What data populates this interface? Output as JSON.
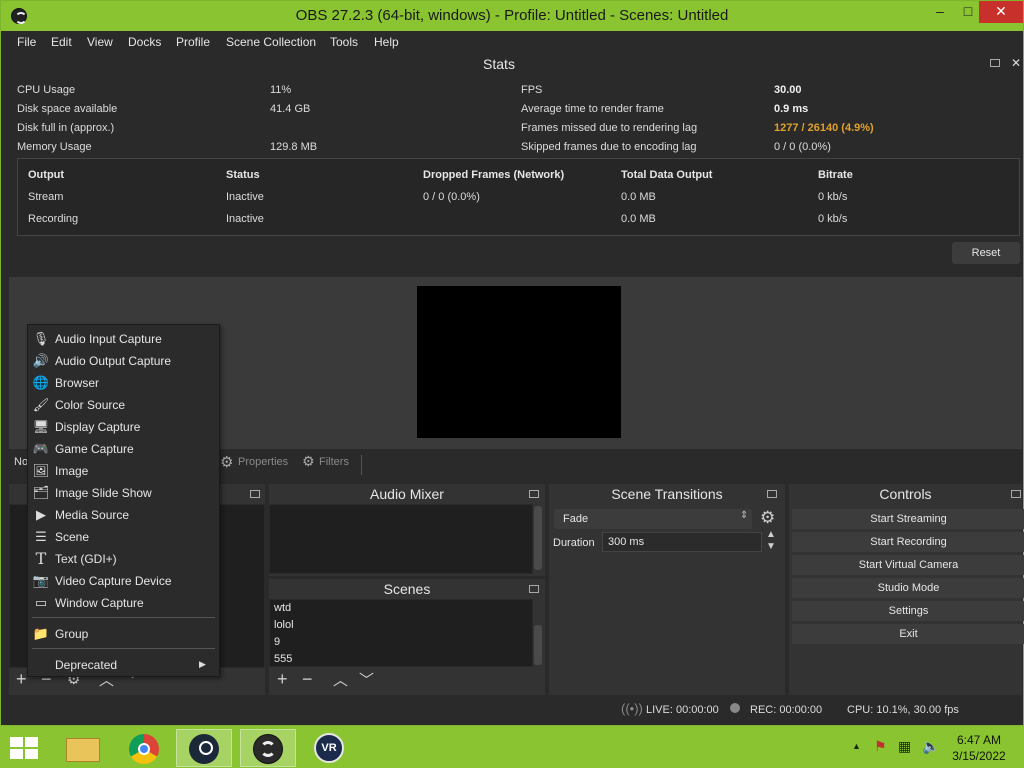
{
  "window": {
    "title": "OBS 27.2.3 (64-bit, windows) - Profile: Untitled - Scenes: Untitled",
    "controls": [
      "–",
      "□",
      "✕"
    ]
  },
  "menu": [
    "File",
    "Edit",
    "View",
    "Docks",
    "Profile",
    "Scene Collection",
    "Tools",
    "Help"
  ],
  "stats": {
    "title": "Stats",
    "left": [
      {
        "label": "CPU Usage",
        "value": "11%"
      },
      {
        "label": "Disk space available",
        "value": "41.4 GB"
      },
      {
        "label": "Disk full in (approx.)",
        "value": ""
      },
      {
        "label": "Memory Usage",
        "value": "129.8 MB"
      }
    ],
    "right": [
      {
        "label": "FPS",
        "value": "30.00"
      },
      {
        "label": "Average time to render frame",
        "value": "0.9 ms"
      },
      {
        "label": "Frames missed due to rendering lag",
        "value": "1277 / 26140 (4.9%)"
      },
      {
        "label": "Skipped frames due to encoding lag",
        "value": "0 / 0 (0.0%)"
      }
    ],
    "table": {
      "headers": [
        "Output",
        "Status",
        "Dropped Frames (Network)",
        "Total Data Output",
        "Bitrate"
      ],
      "rows": [
        [
          "Stream",
          "Inactive",
          "0 / 0 (0.0%)",
          "0.0 MB",
          "0 kb/s"
        ],
        [
          "Recording",
          "Inactive",
          "",
          "0.0 MB",
          "0 kb/s"
        ]
      ]
    },
    "reset_label": "Reset"
  },
  "source_toolbar": {
    "no_source": "No",
    "properties": "Properties",
    "filters": "Filters"
  },
  "audio_mixer": {
    "title": "Audio Mixer"
  },
  "scenes": {
    "title": "Scenes",
    "items": [
      "wtd",
      "lolol",
      "9",
      "555"
    ]
  },
  "scene_transitions": {
    "title": "Scene Transitions",
    "transition": "Fade",
    "duration_label": "Duration",
    "duration_value": "300 ms"
  },
  "controls": {
    "title": "Controls",
    "buttons": [
      "Start Streaming",
      "Start Recording",
      "Start Virtual Camera",
      "Studio Mode",
      "Settings",
      "Exit"
    ]
  },
  "context_menu": {
    "items": [
      {
        "label": "Audio Input Capture",
        "icon": "microphone-icon"
      },
      {
        "label": "Audio Output Capture",
        "icon": "speaker-icon"
      },
      {
        "label": "Browser",
        "icon": "globe-icon"
      },
      {
        "label": "Color Source",
        "icon": "brush-icon"
      },
      {
        "label": "Display Capture",
        "icon": "monitor-icon"
      },
      {
        "label": "Game Capture",
        "icon": "gamepad-icon"
      },
      {
        "label": "Image",
        "icon": "image-icon"
      },
      {
        "label": "Image Slide Show",
        "icon": "slideshow-icon"
      },
      {
        "label": "Media Source",
        "icon": "play-icon"
      },
      {
        "label": "Scene",
        "icon": "list-icon"
      },
      {
        "label": "Text (GDI+)",
        "icon": "text-icon"
      },
      {
        "label": "Video Capture Device",
        "icon": "camera-icon"
      },
      {
        "label": "Window Capture",
        "icon": "window-icon"
      }
    ],
    "group": "Group",
    "deprecated": "Deprecated"
  },
  "statusbar": {
    "live": "LIVE: 00:00:00",
    "rec": "REC: 00:00:00",
    "cpu": "CPU: 10.1%, 30.00 fps"
  },
  "taskbar": {
    "time": "6:47 AM",
    "date": "3/15/2022"
  },
  "colors": {
    "accent_green": "#8ac430",
    "warn": "#e0a02a",
    "close_red": "#c7302b"
  }
}
